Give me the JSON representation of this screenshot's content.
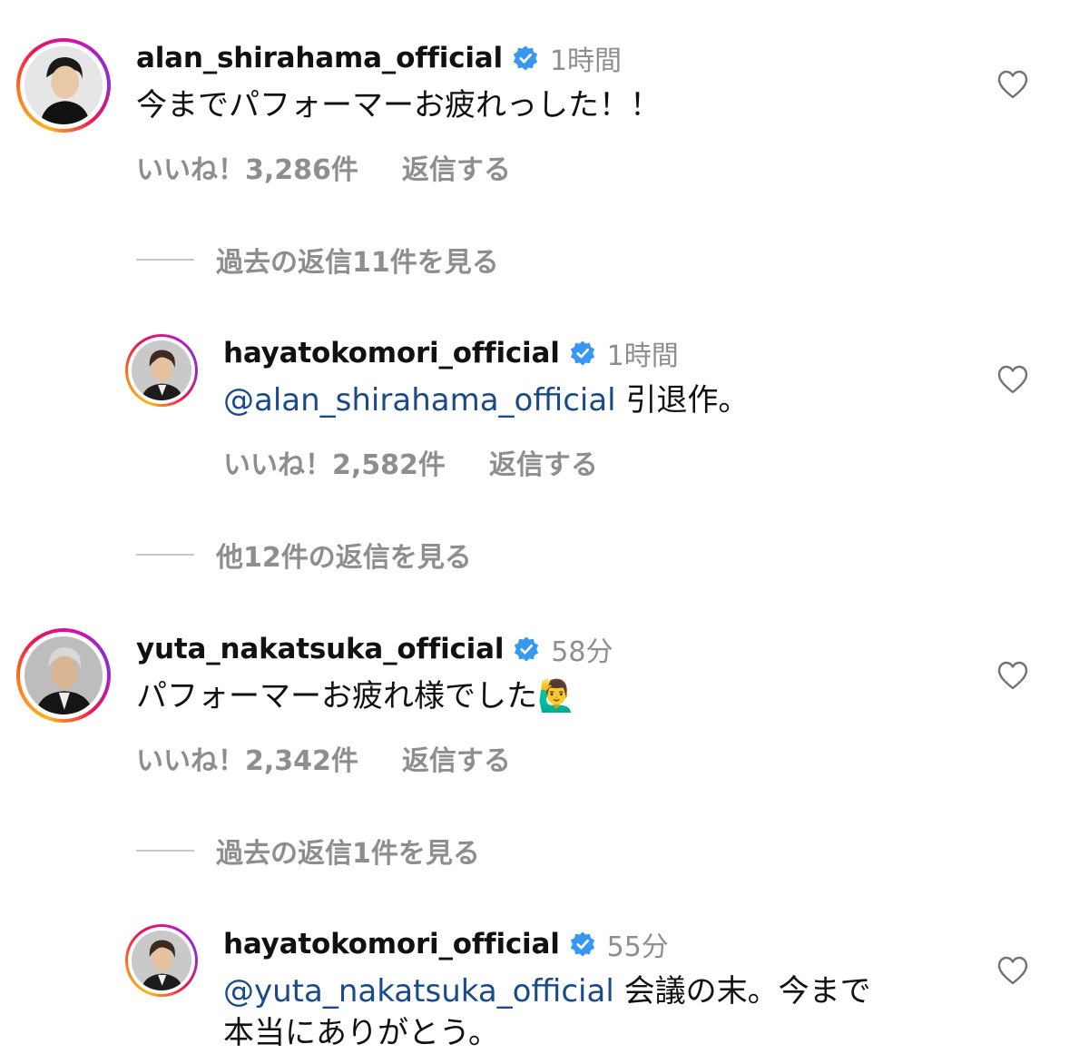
{
  "comments": [
    {
      "username": "alan_shirahama_official",
      "time": "1時間",
      "mention": "",
      "text": "今までパフォーマーお疲れっした！！",
      "likes": "いいね！3,286件",
      "reply": "返信する",
      "view_replies": "過去の返信11件を見る"
    },
    {
      "username": "hayatokomori_official",
      "time": "1時間",
      "mention": "@alan_shirahama_official",
      "text": "引退作。",
      "likes": "いいね！2,582件",
      "reply": "返信する",
      "view_replies": "他12件の返信を見る"
    },
    {
      "username": "yuta_nakatsuka_official",
      "time": "58分",
      "mention": "",
      "text": "パフォーマーお疲れ様でした🙋‍♂️",
      "likes": "いいね！2,342件",
      "reply": "返信する",
      "view_replies": "過去の返信1件を見る"
    },
    {
      "username": "hayatokomori_official",
      "time": "55分",
      "mention": "@yuta_nakatsuka_official",
      "text": "会議の末。今まで",
      "text_line2": "本当にありがとう。"
    }
  ],
  "colors": {
    "verified": "#3897f0",
    "mention": "#1a4a8a",
    "muted": "#8e8e8e"
  },
  "icons": [
    "verified-badge-icon",
    "heart-icon"
  ]
}
